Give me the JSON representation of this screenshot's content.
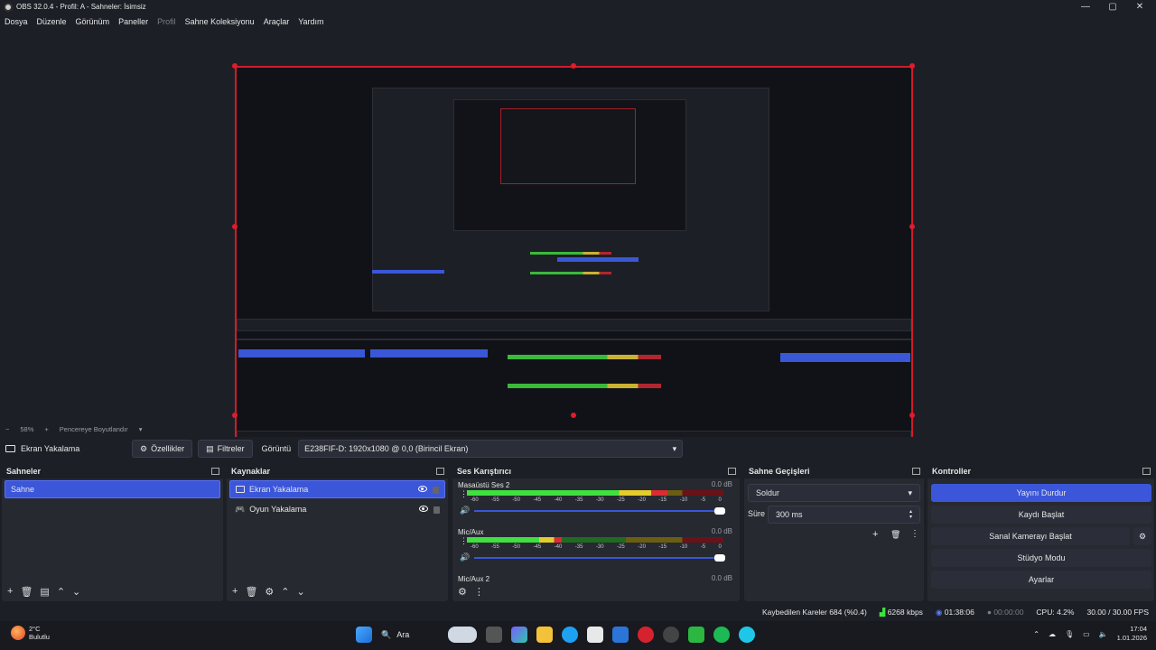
{
  "window": {
    "title": "OBS 32.0.4 - Profil: A - Sahneler: İsimsiz",
    "minimize": "—",
    "maximize": "▢",
    "close": "✕"
  },
  "menu": [
    "Dosya",
    "Düzenle",
    "Görünüm",
    "Paneller",
    "Profil",
    "Sahne Koleksiyonu",
    "Araçlar",
    "Yardım"
  ],
  "zoom": {
    "minus": "−",
    "level": "58%",
    "plus": "+",
    "mode": "Pencereye Boyutlandır"
  },
  "context": {
    "source_name": "Ekran Yakalama",
    "properties": "Özellikler",
    "filters": "Filtreler",
    "display_label": "Görüntü",
    "display_value": "E238FIF-D: 1920x1080 @ 0,0 (Birincil Ekran)"
  },
  "scenes": {
    "title": "Sahneler",
    "items": [
      "Sahne"
    ]
  },
  "sources": {
    "title": "Kaynaklar",
    "items": [
      "Ekran Yakalama",
      "Oyun Yakalama"
    ]
  },
  "mixer": {
    "title": "Ses Karıştırıcı",
    "channels": [
      {
        "name": "Masaüstü Ses 2",
        "db": "0.0 dB",
        "level": 0.78
      },
      {
        "name": "Mic/Aux",
        "db": "0.0 dB",
        "level": 0.37
      },
      {
        "name": "Mic/Aux 2",
        "db": "0.0 dB",
        "level": 0.0
      }
    ],
    "ticks": [
      "-60",
      "-55",
      "-50",
      "-45",
      "-40",
      "-35",
      "-30",
      "-25",
      "-20",
      "-15",
      "-10",
      "-5",
      "0"
    ]
  },
  "transitions": {
    "title": "Sahne Geçişleri",
    "selected": "Soldur",
    "duration_label": "Süre",
    "duration_value": "300 ms"
  },
  "controls": {
    "title": "Kontroller",
    "stop_stream": "Yayını Durdur",
    "start_record": "Kaydı Başlat",
    "start_vcam": "Sanal Kamerayı Başlat",
    "studio_mode": "Stüdyo Modu",
    "settings": "Ayarlar"
  },
  "status": {
    "dropped": "Kaybedilen Kareler 684 (%0.4)",
    "bitrate": "6268 kbps",
    "stream_time": "01:38:06",
    "rec_time": "00:00:00",
    "cpu": "CPU: 4.2%",
    "fps": "30.00 / 30.00 FPS"
  },
  "taskbar": {
    "temp": "2°C",
    "weather": "Bulutlu",
    "search": "Ara",
    "time": "17:04",
    "date": "1.01.2026"
  },
  "colors": {
    "accent": "#3b56d9",
    "selection_border": "#d11b2b",
    "meter_green": "#3fe03f",
    "meter_yellow": "#e3cc2c",
    "meter_red": "#dd2b35"
  }
}
